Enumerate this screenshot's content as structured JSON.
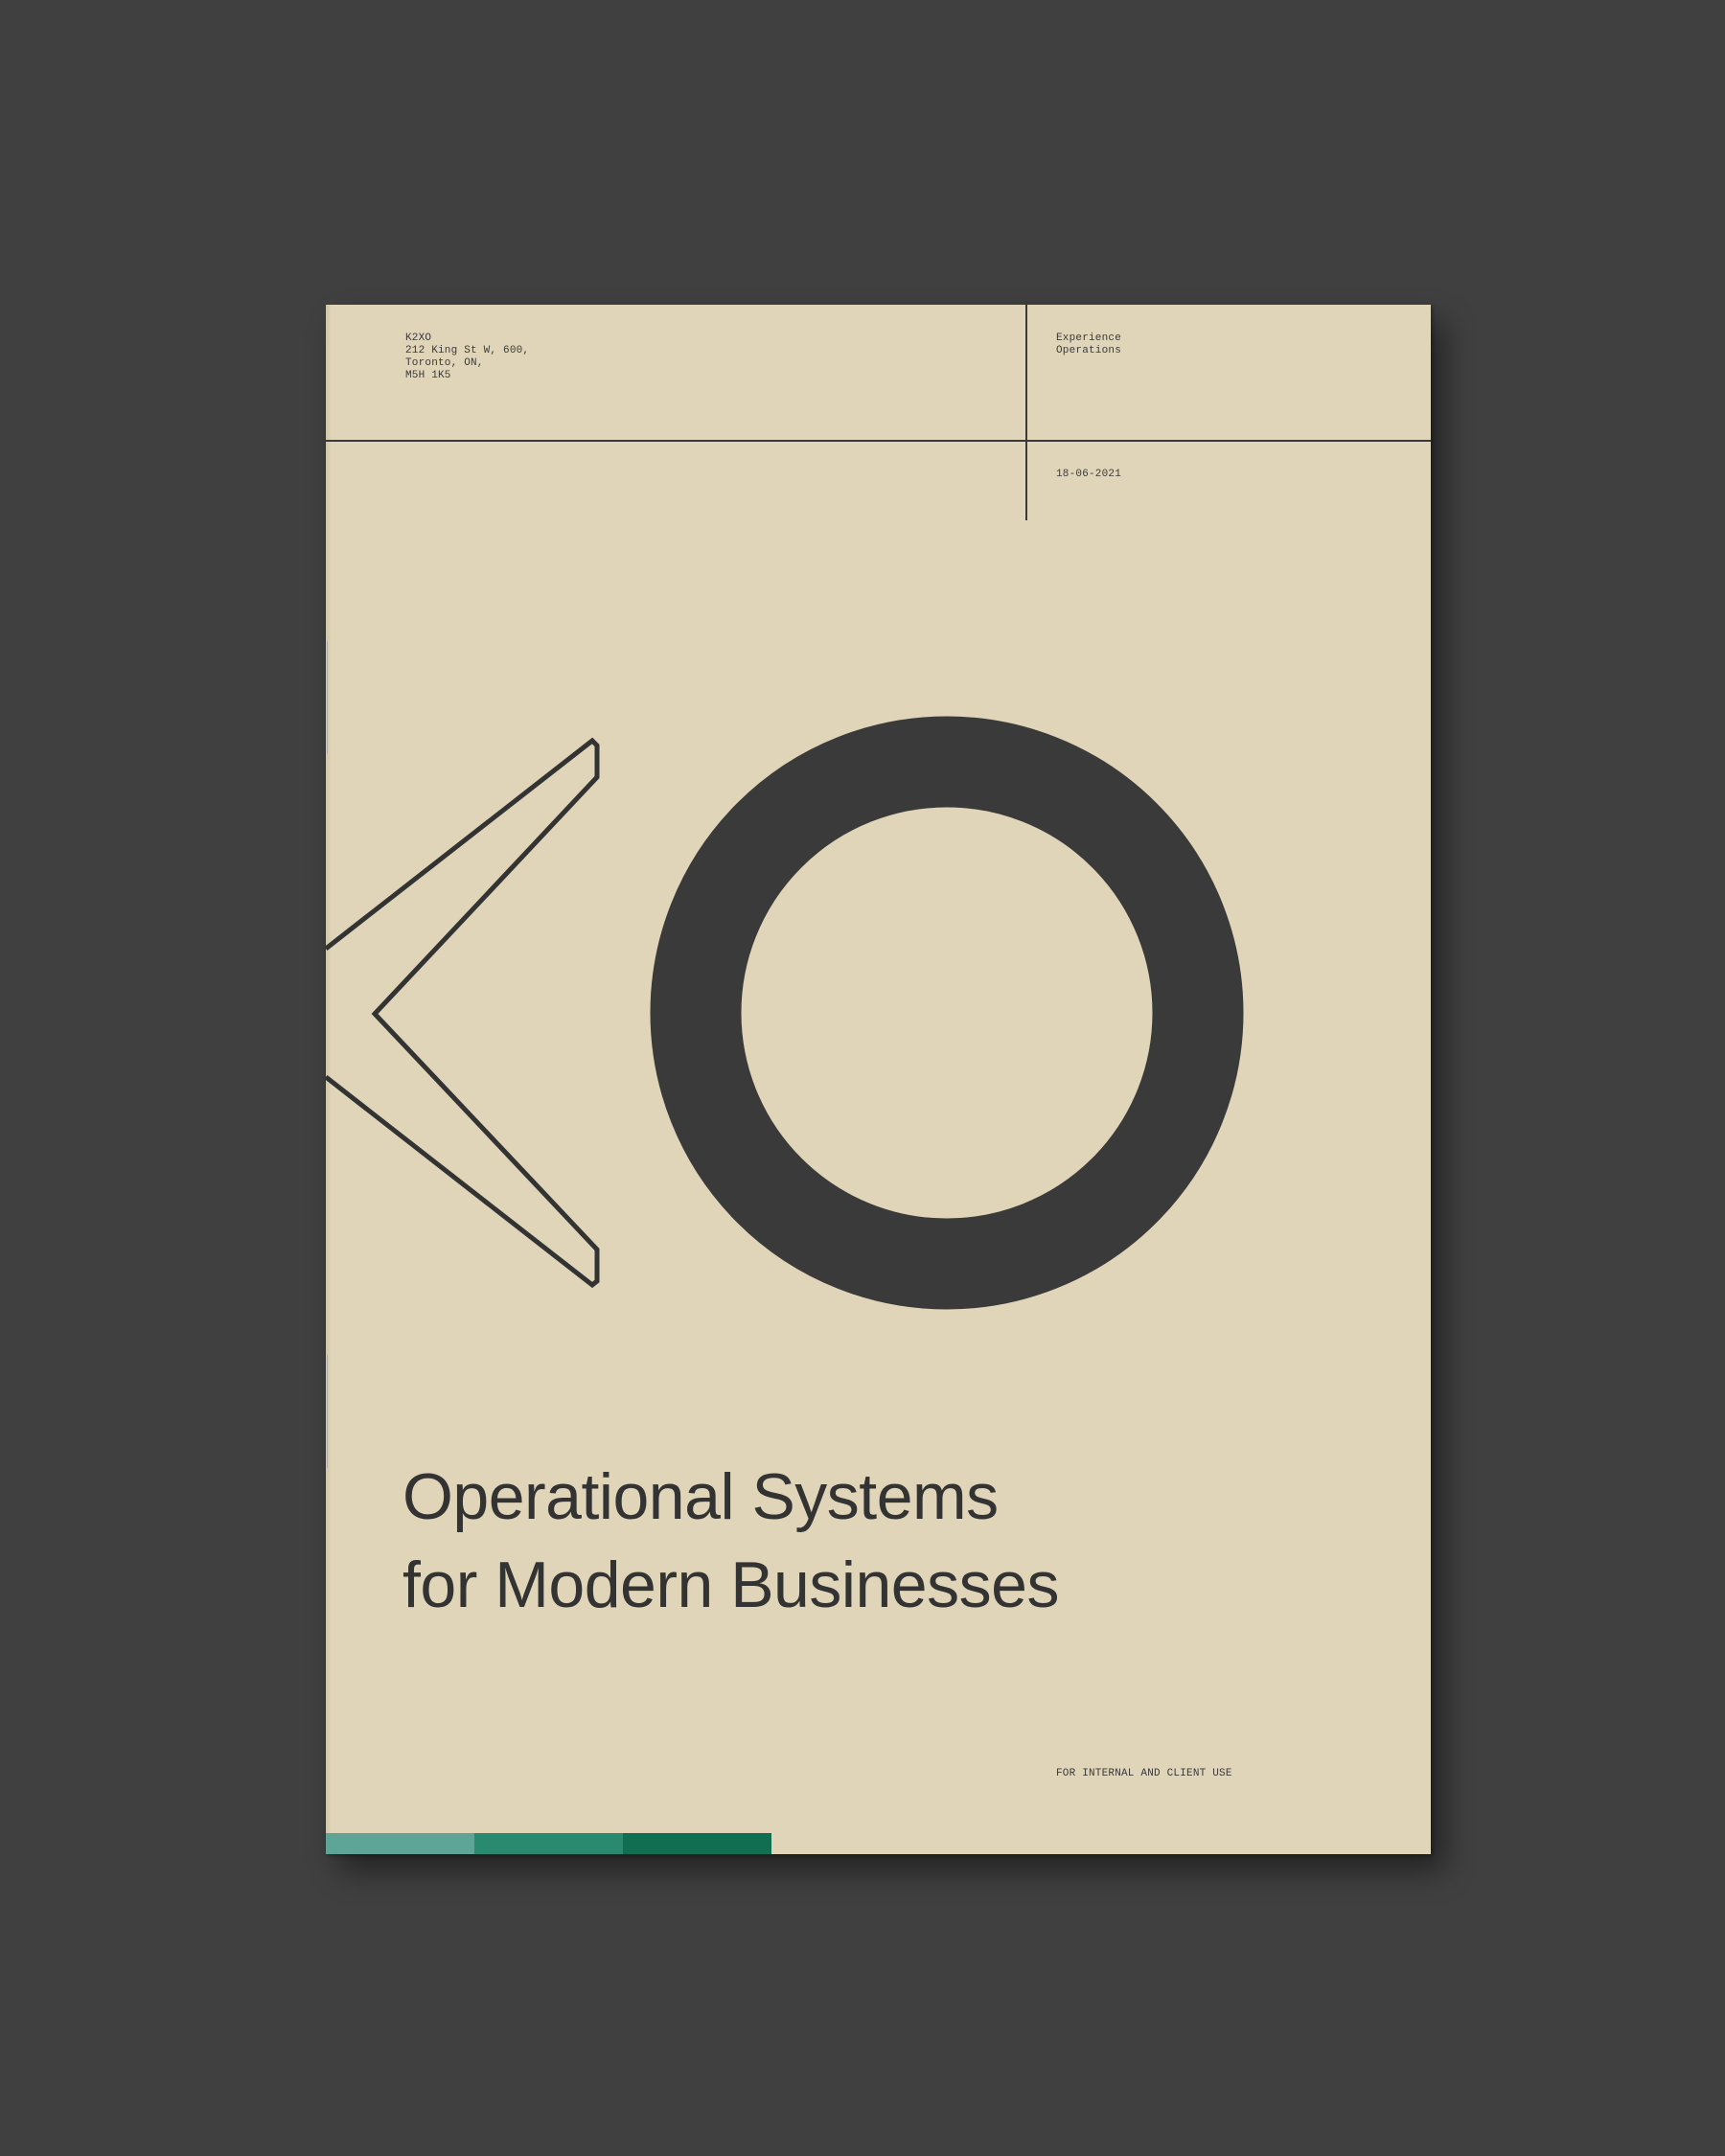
{
  "cover": {
    "address_lines": [
      "K2XO",
      "212 King St W, 600,",
      "Toronto, ON,",
      "M5H 1K5"
    ],
    "department_lines": [
      "Experience",
      "Operations"
    ],
    "date": "18-06-2021",
    "title_lines": [
      "Operational Systems",
      "for Modern Businesses"
    ],
    "usage_note": "FOR INTERNAL AND CLIENT USE",
    "logo_letters": "KO",
    "colors": {
      "paper": "#e0d5b8",
      "ink": "#3a3a3a",
      "stripe_light": "#5fa597",
      "stripe_mid": "#2a8a6f",
      "stripe_dark": "#116e50"
    }
  }
}
